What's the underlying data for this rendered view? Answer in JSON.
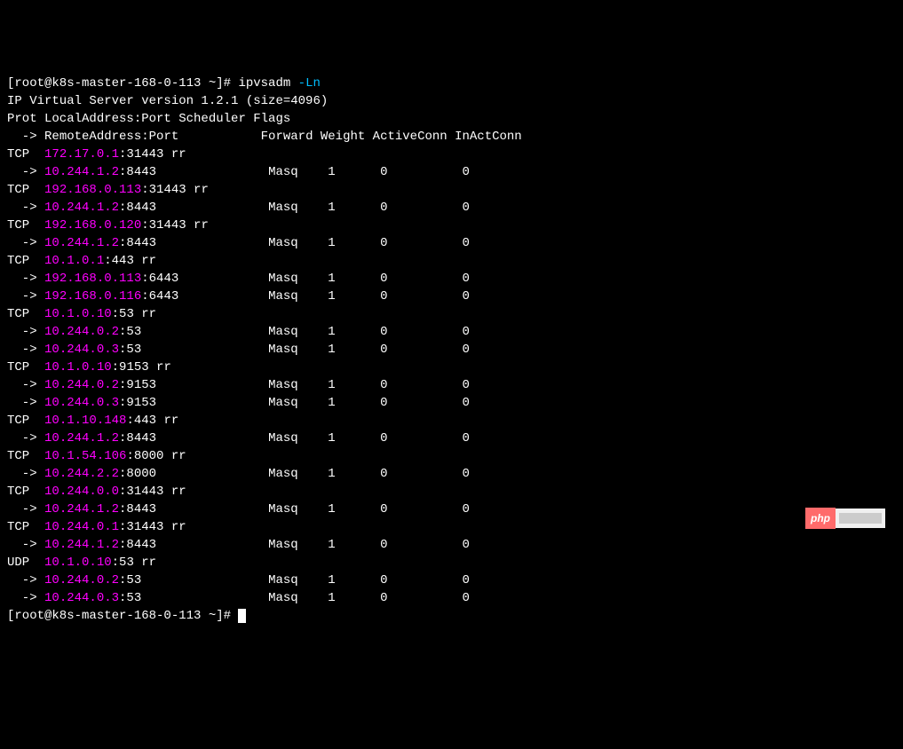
{
  "prompt1": {
    "user_host": "[root@k8s-master-168-0-113 ~]# ",
    "command": "ipvsadm ",
    "option": "-Ln"
  },
  "version_line": "IP Virtual Server version 1.2.1 (size=4096)",
  "header1": "Prot LocalAddress:Port Scheduler Flags",
  "header2_arrow": "  -> ",
  "header2_rest": "RemoteAddress:Port           Forward Weight ActiveConn InActConn",
  "vs": [
    {
      "prot": "TCP  ",
      "ip": "172.17.0.1",
      "port_sched": ":31443 rr",
      "rs": [
        {
          "arrow": "  -> ",
          "ip": "10.244.1.2",
          "port": ":8443               ",
          "forward": "Masq    ",
          "weight": "1      ",
          "active": "0          ",
          "inact": "0"
        }
      ]
    },
    {
      "prot": "TCP  ",
      "ip": "192.168.0.113",
      "port_sched": ":31443 rr",
      "rs": [
        {
          "arrow": "  -> ",
          "ip": "10.244.1.2",
          "port": ":8443               ",
          "forward": "Masq    ",
          "weight": "1      ",
          "active": "0          ",
          "inact": "0"
        }
      ]
    },
    {
      "prot": "TCP  ",
      "ip": "192.168.0.120",
      "port_sched": ":31443 rr",
      "rs": [
        {
          "arrow": "  -> ",
          "ip": "10.244.1.2",
          "port": ":8443               ",
          "forward": "Masq    ",
          "weight": "1      ",
          "active": "0          ",
          "inact": "0"
        }
      ]
    },
    {
      "prot": "TCP  ",
      "ip": "10.1.0.1",
      "port_sched": ":443 rr",
      "rs": [
        {
          "arrow": "  -> ",
          "ip": "192.168.0.113",
          "port": ":6443            ",
          "forward": "Masq    ",
          "weight": "1      ",
          "active": "0          ",
          "inact": "0"
        },
        {
          "arrow": "  -> ",
          "ip": "192.168.0.116",
          "port": ":6443            ",
          "forward": "Masq    ",
          "weight": "1      ",
          "active": "0          ",
          "inact": "0"
        }
      ]
    },
    {
      "prot": "TCP  ",
      "ip": "10.1.0.10",
      "port_sched": ":53 rr",
      "rs": [
        {
          "arrow": "  -> ",
          "ip": "10.244.0.2",
          "port": ":53                 ",
          "forward": "Masq    ",
          "weight": "1      ",
          "active": "0          ",
          "inact": "0"
        },
        {
          "arrow": "  -> ",
          "ip": "10.244.0.3",
          "port": ":53                 ",
          "forward": "Masq    ",
          "weight": "1      ",
          "active": "0          ",
          "inact": "0"
        }
      ]
    },
    {
      "prot": "TCP  ",
      "ip": "10.1.0.10",
      "port_sched": ":9153 rr",
      "rs": [
        {
          "arrow": "  -> ",
          "ip": "10.244.0.2",
          "port": ":9153               ",
          "forward": "Masq    ",
          "weight": "1      ",
          "active": "0          ",
          "inact": "0"
        },
        {
          "arrow": "  -> ",
          "ip": "10.244.0.3",
          "port": ":9153               ",
          "forward": "Masq    ",
          "weight": "1      ",
          "active": "0          ",
          "inact": "0"
        }
      ]
    },
    {
      "prot": "TCP  ",
      "ip": "10.1.10.148",
      "port_sched": ":443 rr",
      "rs": [
        {
          "arrow": "  -> ",
          "ip": "10.244.1.2",
          "port": ":8443               ",
          "forward": "Masq    ",
          "weight": "1      ",
          "active": "0          ",
          "inact": "0"
        }
      ]
    },
    {
      "prot": "TCP  ",
      "ip": "10.1.54.106",
      "port_sched": ":8000 rr",
      "rs": [
        {
          "arrow": "  -> ",
          "ip": "10.244.2.2",
          "port": ":8000               ",
          "forward": "Masq    ",
          "weight": "1      ",
          "active": "0          ",
          "inact": "0"
        }
      ]
    },
    {
      "prot": "TCP  ",
      "ip": "10.244.0.0",
      "port_sched": ":31443 rr",
      "rs": [
        {
          "arrow": "  -> ",
          "ip": "10.244.1.2",
          "port": ":8443               ",
          "forward": "Masq    ",
          "weight": "1      ",
          "active": "0          ",
          "inact": "0"
        }
      ]
    },
    {
      "prot": "TCP  ",
      "ip": "10.244.0.1",
      "port_sched": ":31443 rr",
      "rs": [
        {
          "arrow": "  -> ",
          "ip": "10.244.1.2",
          "port": ":8443               ",
          "forward": "Masq    ",
          "weight": "1      ",
          "active": "0          ",
          "inact": "0"
        }
      ]
    },
    {
      "prot": "UDP  ",
      "ip": "10.1.0.10",
      "port_sched": ":53 rr",
      "rs": [
        {
          "arrow": "  -> ",
          "ip": "10.244.0.2",
          "port": ":53                 ",
          "forward": "Masq    ",
          "weight": "1      ",
          "active": "0          ",
          "inact": "0"
        },
        {
          "arrow": "  -> ",
          "ip": "10.244.0.3",
          "port": ":53                 ",
          "forward": "Masq    ",
          "weight": "1      ",
          "active": "0          ",
          "inact": "0"
        }
      ]
    }
  ],
  "prompt2": {
    "user_host": "[root@k8s-master-168-0-113 ~]# "
  },
  "watermark": {
    "left": "php"
  }
}
